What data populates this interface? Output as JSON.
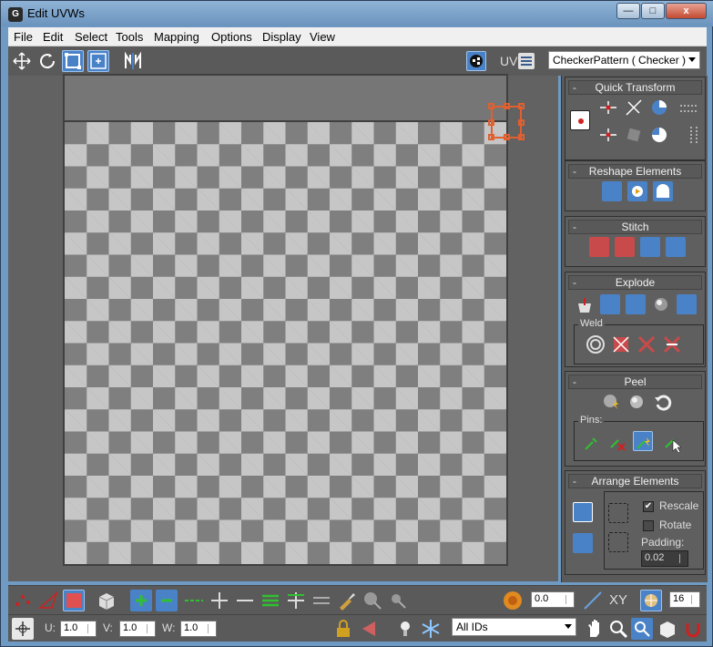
{
  "window": {
    "title": "Edit UVWs",
    "icon": "3ds-logo-icon",
    "min": "—",
    "max": "□",
    "close": "x"
  },
  "menu": [
    "File",
    "Edit",
    "Select",
    "Tools",
    "Mapping",
    "Options",
    "Display",
    "View"
  ],
  "toolbar": {
    "uv_label": "UV",
    "texture_dropdown": "CheckerPattern  ( Checker )"
  },
  "panel": {
    "quick_transform": "Quick Transform",
    "reshape": "Reshape Elements",
    "stitch": "Stitch",
    "explode": "Explode",
    "weld": "Weld",
    "peel": "Peel",
    "pins": "Pins:",
    "arrange": "Arrange Elements",
    "rescale": "Rescale",
    "rotate": "Rotate",
    "padding_label": "Padding:",
    "padding": "0.02",
    "collapse": "-"
  },
  "bottom": {
    "rotate_value": "0.0",
    "xy": "XY",
    "grid_count": "16",
    "u_label": "U:",
    "u_value": "1.0",
    "v_label": "V:",
    "v_value": "1.0",
    "w_label": "W:",
    "w_value": "1.0",
    "ids_dropdown": "All IDs"
  },
  "colors": {
    "accent": "#4a82c8",
    "gizmo": "#e06030",
    "checker_light": "#c6c6c6",
    "checker_dark": "#7f7f7f"
  }
}
